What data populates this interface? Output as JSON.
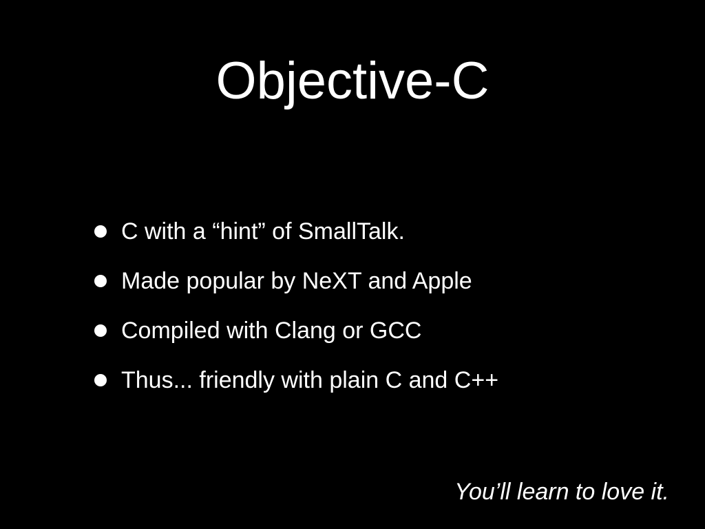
{
  "slide": {
    "title": "Objective-C",
    "bullets": [
      "C with a “hint” of SmallTalk.",
      "Made popular by NeXT and Apple",
      "Compiled with Clang or GCC",
      "Thus... friendly with plain C and C++"
    ],
    "footer_note": "You’ll learn to love it."
  },
  "colors": {
    "background": "#000000",
    "text": "#ffffff"
  }
}
